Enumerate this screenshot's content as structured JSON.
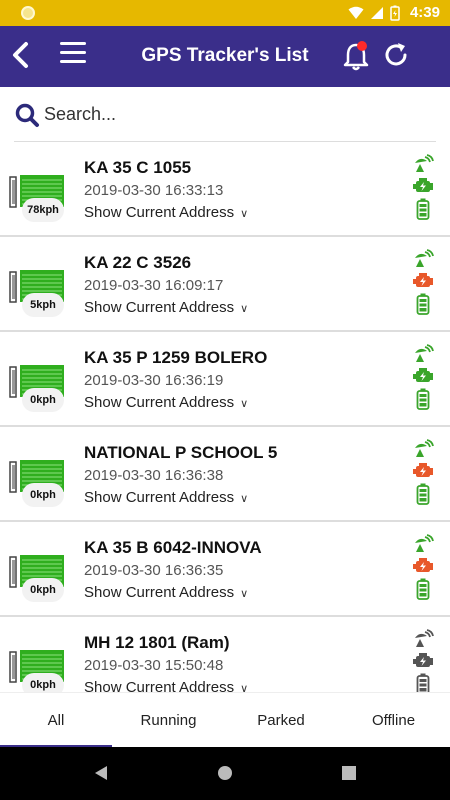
{
  "status_bar": {
    "time": "4:39"
  },
  "appbar": {
    "title": "GPS Tracker's List"
  },
  "search": {
    "placeholder": "Search..."
  },
  "trackers": [
    {
      "name": "KA 35 C 1055",
      "timestamp": "2019-03-30 16:33:13",
      "address_label": "Show Current Address",
      "speed": "78kph",
      "status": [
        "green",
        "green",
        "green"
      ]
    },
    {
      "name": "KA 22 C 3526",
      "timestamp": "2019-03-30 16:09:17",
      "address_label": "Show Current Address",
      "speed": "5kph",
      "status": [
        "green",
        "orange",
        "green"
      ]
    },
    {
      "name": "KA 35 P 1259 BOLERO",
      "timestamp": "2019-03-30 16:36:19",
      "address_label": "Show Current Address",
      "speed": "0kph",
      "status": [
        "green",
        "green",
        "green"
      ]
    },
    {
      "name": "NATIONAL P SCHOOL 5",
      "timestamp": "2019-03-30 16:36:38",
      "address_label": "Show Current Address",
      "speed": "0kph",
      "status": [
        "green",
        "orange",
        "green"
      ]
    },
    {
      "name": "KA 35 B 6042-INNOVA",
      "timestamp": "2019-03-30 16:36:35",
      "address_label": "Show Current Address",
      "speed": "0kph",
      "status": [
        "green",
        "orange",
        "green"
      ]
    },
    {
      "name": "MH 12 1801 (Ram)",
      "timestamp": "2019-03-30 15:50:48",
      "address_label": "Show Current Address",
      "speed": "0kph",
      "status": [
        "gray",
        "gray",
        "gray"
      ]
    }
  ],
  "tabs": [
    {
      "label": "All",
      "active": true
    },
    {
      "label": "Running",
      "active": false
    },
    {
      "label": "Parked",
      "active": false
    },
    {
      "label": "Offline",
      "active": false
    }
  ],
  "colors": {
    "primary": "#3a2e8a",
    "status_bar": "#e6b800",
    "green": "#3aa52b",
    "orange": "#e8582a",
    "gray": "#555555",
    "notification": "#ff2a2a"
  }
}
